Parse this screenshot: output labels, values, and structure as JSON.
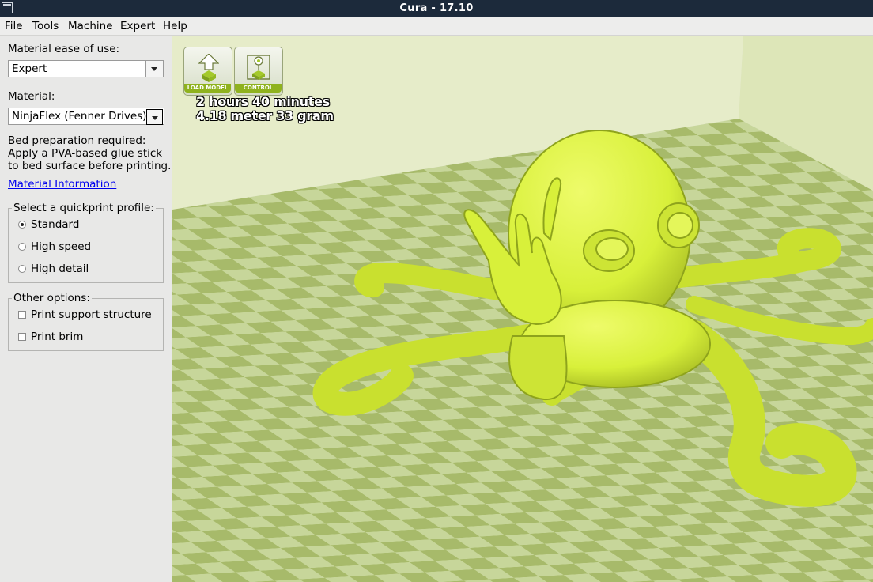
{
  "window": {
    "title": "Cura - 17.10"
  },
  "menu": {
    "items": [
      "File",
      "Tools",
      "Machine",
      "Expert",
      "Help"
    ]
  },
  "panel": {
    "ease_label": "Material ease of use:",
    "ease_value": "Expert",
    "material_label": "Material:",
    "material_value": "NinjaFlex (Fenner Drives)",
    "bed_lines": [
      "Bed preparation required:",
      "Apply a PVA-based glue stick",
      "to bed surface before printing."
    ],
    "material_link": "Material Information",
    "quickprint": {
      "legend": "Select a quickprint profile:",
      "options": [
        "Standard",
        "High speed",
        "High detail"
      ],
      "selected": "Standard"
    },
    "other": {
      "legend": "Other options:",
      "options": [
        "Print support structure",
        "Print brim"
      ]
    }
  },
  "viewport": {
    "buttons": {
      "load": "LOAD MODEL",
      "control": "CONTROL"
    },
    "print_time": "2 hours 40 minutes",
    "print_usage": "4.18 meter 33 gram",
    "colors": {
      "model": "#d8f03a",
      "floor_light": "#c7d69a",
      "floor_dark": "#a7ba6a",
      "wall": "#e2e9c4"
    }
  }
}
